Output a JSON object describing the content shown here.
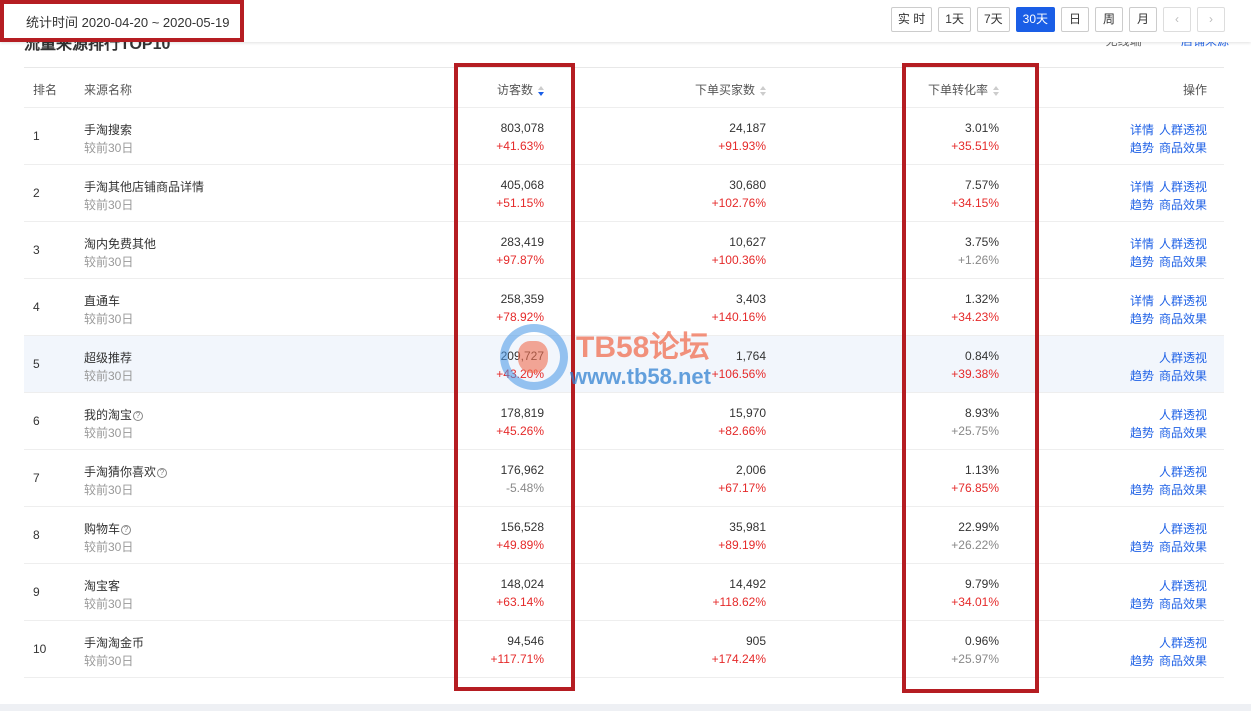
{
  "date_range": "统计时间 2020-04-20 ~ 2020-05-19",
  "page_title": "流量来源排行TOP10",
  "top_links": [
    "无线端",
    "店铺来源"
  ],
  "range_buttons": [
    {
      "label": "实 时",
      "active": false
    },
    {
      "label": "1天",
      "active": false
    },
    {
      "label": "7天",
      "active": false
    },
    {
      "label": "30天",
      "active": true
    },
    {
      "label": "日",
      "active": false
    },
    {
      "label": "周",
      "active": false
    },
    {
      "label": "月",
      "active": false
    }
  ],
  "nav_arrows": [
    "‹",
    "›"
  ],
  "columns": {
    "rank": "排名",
    "name": "来源名称",
    "visitors": "访客数",
    "buyers": "下单买家数",
    "rate": "下单转化率",
    "ops": "操作"
  },
  "ops_labels": {
    "detail": "详情",
    "crowd": "人群透视",
    "trend": "趋势",
    "effect": "商品效果"
  },
  "rows": [
    {
      "rank": "1",
      "name": "手淘搜索",
      "sub": "较前30日",
      "help": false,
      "visitors": "803,078",
      "visitors_chg": "+41.63%",
      "buyers": "24,187",
      "buyers_chg": "+91.93%",
      "rate": "3.01%",
      "rate_chg": "+35.51%",
      "has_detail": true
    },
    {
      "rank": "2",
      "name": "手淘其他店铺商品详情",
      "sub": "较前30日",
      "help": false,
      "visitors": "405,068",
      "visitors_chg": "+51.15%",
      "buyers": "30,680",
      "buyers_chg": "+102.76%",
      "rate": "7.57%",
      "rate_chg": "+34.15%",
      "has_detail": true
    },
    {
      "rank": "3",
      "name": "淘内免费其他",
      "sub": "较前30日",
      "help": false,
      "visitors": "283,419",
      "visitors_chg": "+97.87%",
      "buyers": "10,627",
      "buyers_chg": "+100.36%",
      "rate": "3.75%",
      "rate_chg": "+1.26%",
      "has_detail": true
    },
    {
      "rank": "4",
      "name": "直通车",
      "sub": "较前30日",
      "help": false,
      "visitors": "258,359",
      "visitors_chg": "+78.92%",
      "buyers": "3,403",
      "buyers_chg": "+140.16%",
      "rate": "1.32%",
      "rate_chg": "+34.23%",
      "has_detail": true
    },
    {
      "rank": "5",
      "name": "超级推荐",
      "sub": "较前30日",
      "help": false,
      "visitors": "209,727",
      "visitors_chg": "+43.20%",
      "buyers": "1,764",
      "buyers_chg": "+106.56%",
      "rate": "0.84%",
      "rate_chg": "+39.38%",
      "has_detail": false
    },
    {
      "rank": "6",
      "name": "我的淘宝",
      "sub": "较前30日",
      "help": true,
      "visitors": "178,819",
      "visitors_chg": "+45.26%",
      "buyers": "15,970",
      "buyers_chg": "+82.66%",
      "rate": "8.93%",
      "rate_chg": "+25.75%",
      "has_detail": false
    },
    {
      "rank": "7",
      "name": "手淘猜你喜欢",
      "sub": "较前30日",
      "help": true,
      "visitors": "176,962",
      "visitors_chg": "-5.48%",
      "buyers": "2,006",
      "buyers_chg": "+67.17%",
      "rate": "1.13%",
      "rate_chg": "+76.85%",
      "has_detail": false
    },
    {
      "rank": "8",
      "name": "购物车",
      "sub": "较前30日",
      "help": true,
      "visitors": "156,528",
      "visitors_chg": "+49.89%",
      "buyers": "35,981",
      "buyers_chg": "+89.19%",
      "rate": "22.99%",
      "rate_chg": "+26.22%",
      "has_detail": false
    },
    {
      "rank": "9",
      "name": "淘宝客",
      "sub": "较前30日",
      "help": false,
      "visitors": "148,024",
      "visitors_chg": "+63.14%",
      "buyers": "14,492",
      "buyers_chg": "+118.62%",
      "rate": "9.79%",
      "rate_chg": "+34.01%",
      "has_detail": false
    },
    {
      "rank": "10",
      "name": "手淘淘金币",
      "sub": "较前30日",
      "help": false,
      "visitors": "94,546",
      "visitors_chg": "+117.71%",
      "buyers": "905",
      "buyers_chg": "+174.24%",
      "rate": "0.96%",
      "rate_chg": "+25.97%",
      "has_detail": false
    }
  ],
  "watermark": {
    "title": "TB58论坛",
    "url": "www.tb58.net"
  },
  "colors": {
    "accent": "#1a5ee6",
    "up": "#e52a2a",
    "highlight_box": "#b51d22"
  }
}
